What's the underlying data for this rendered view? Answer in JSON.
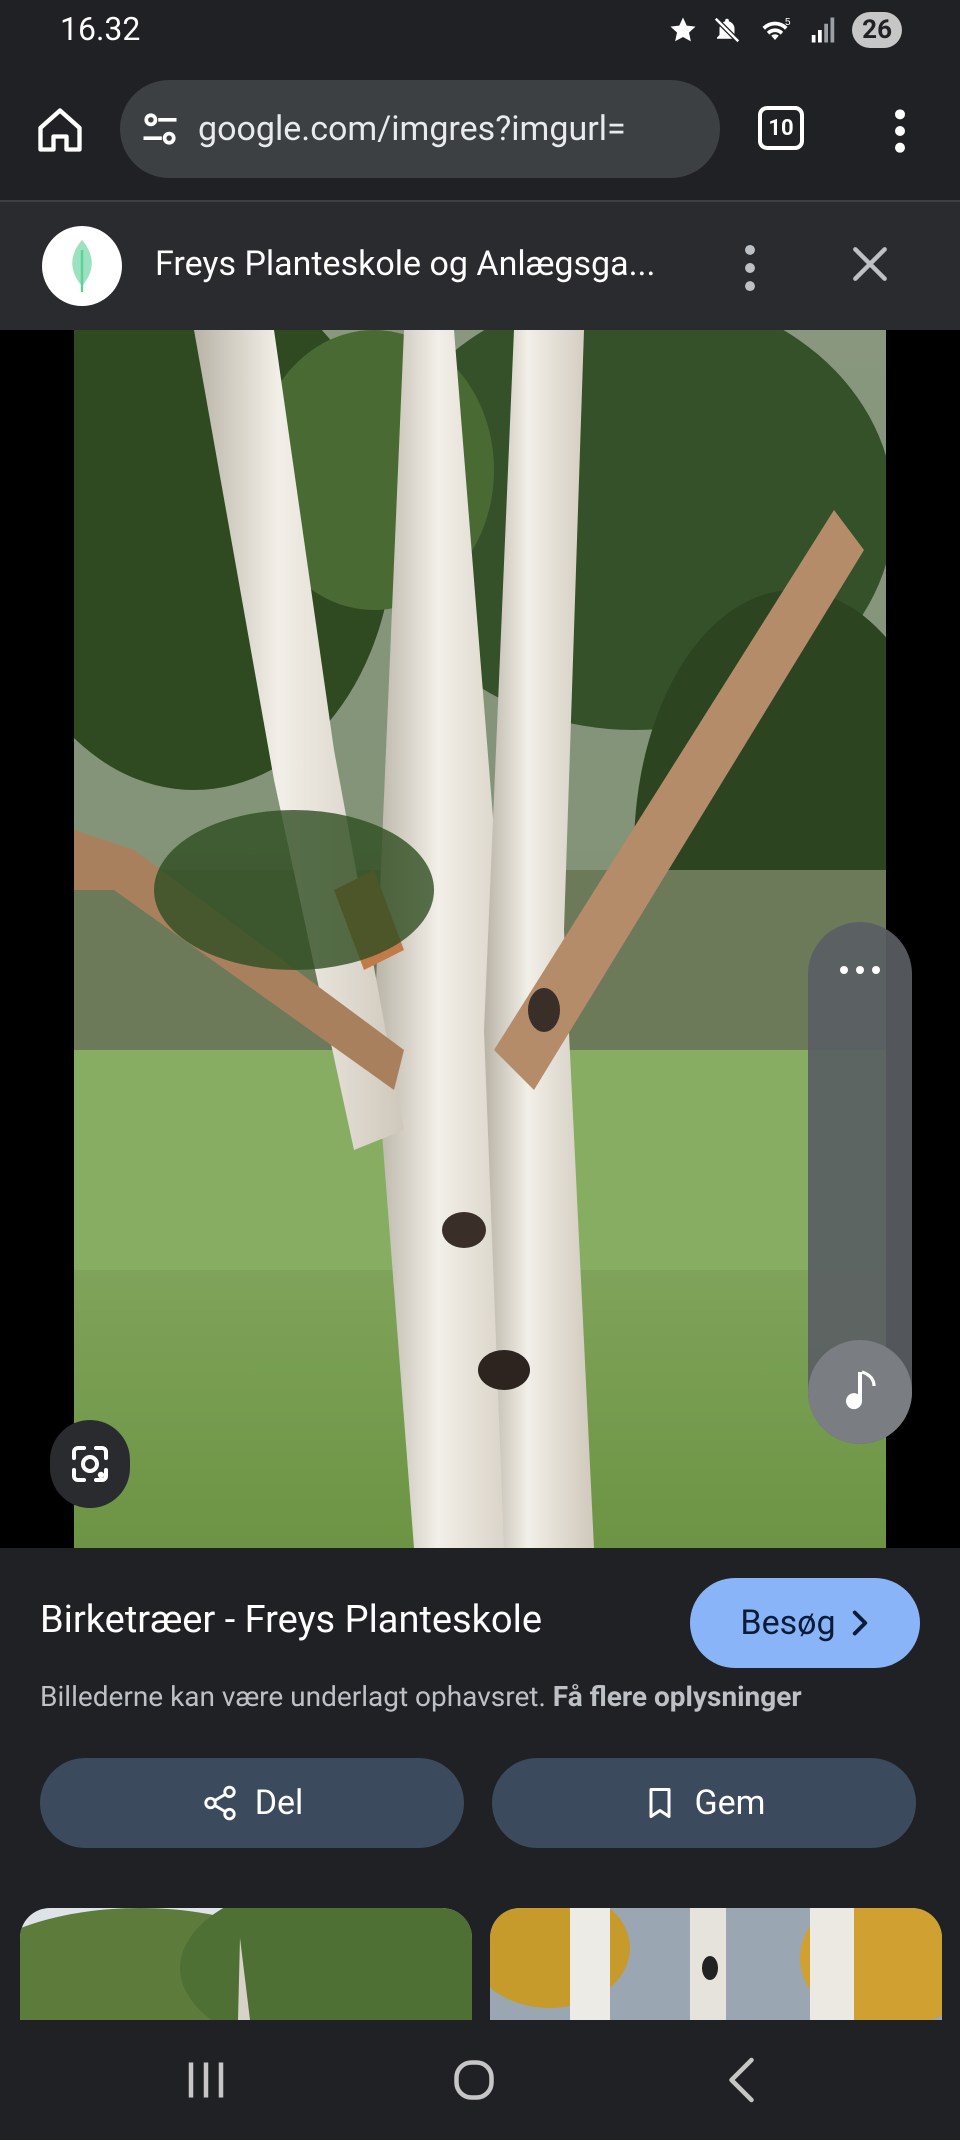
{
  "status": {
    "time": "16.32",
    "battery": "26",
    "icons": [
      "star-icon",
      "mute-icon",
      "wifi-icon",
      "signal-icon"
    ]
  },
  "browser": {
    "url": "google.com/imgres?imgurl=",
    "tab_count": "10",
    "icons": [
      "home-icon",
      "tune-icon",
      "more-vert-icon"
    ]
  },
  "site": {
    "title": "Freys Planteskole og Anlægsga...",
    "icons": [
      "site-logo-icon",
      "more-vert-icon",
      "close-icon"
    ]
  },
  "image": {
    "subject": "birch tree",
    "icons": [
      "lens-icon",
      "more-horiz-icon",
      "music-note-icon"
    ]
  },
  "result": {
    "title": "Birketræer - Freys Planteskole",
    "visit_label": "Besøg",
    "copyright_text": "Billederne kan være underlagt ophavsret.",
    "more_info_link": "Få flere oplysninger",
    "share_label": "Del",
    "save_label": "Gem"
  },
  "nav": {
    "icons": [
      "recents-icon",
      "home-circle-icon",
      "back-icon"
    ]
  },
  "colors": {
    "background": "#202124",
    "accent": "#8ab4f8",
    "button": "#3c4a5e"
  }
}
